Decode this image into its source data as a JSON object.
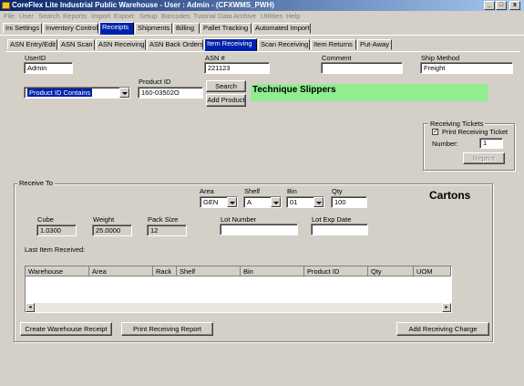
{
  "window": {
    "title": "CoreFlex Lite Industrial Public Warehouse - User : Admin - (CFXWMS_PWH)"
  },
  "menu": [
    "File",
    "User",
    "Search",
    "Reports",
    "Import",
    "Export",
    "Setup",
    "Barcodes",
    "Tutorial Data",
    "Archive",
    "Utilities",
    "Help"
  ],
  "main_tabs": [
    {
      "label": "Ini Settings"
    },
    {
      "label": "Inventory Control"
    },
    {
      "label": "Receipts"
    },
    {
      "label": "Shipments"
    },
    {
      "label": "Billing"
    },
    {
      "label": "Pallet Tracking"
    },
    {
      "label": "Automated Import"
    }
  ],
  "sub_tabs": [
    {
      "label": "ASN Entry/Edit"
    },
    {
      "label": "ASN Scan"
    },
    {
      "label": "ASN Receiving"
    },
    {
      "label": "ASN Back Orders"
    },
    {
      "label": "Item Receiving"
    },
    {
      "label": "Scan Receiving"
    },
    {
      "label": "Item Returns"
    },
    {
      "label": "Put-Away"
    }
  ],
  "form": {
    "userid_label": "UserID",
    "userid_value": "Admin",
    "asn_label": "ASN #",
    "asn_value": "221123",
    "comment_label": "Comment",
    "comment_value": "",
    "shipmethod_label": "Ship Method",
    "shipmethod_value": "Freight",
    "search_mode": "Product ID Contains",
    "productid_label": "Product ID",
    "productid_value": "160-03502O",
    "search_button": "Search",
    "add_product_button": "Add Product",
    "product_description": "Technique Slippers"
  },
  "receiving_tickets": {
    "title": "Receiving Tickets",
    "print_label": "Print Receiving Ticket",
    "print_checked": true,
    "number_label": "Number:",
    "number_value": "1",
    "reprint_button": "Reprint"
  },
  "receive_to": {
    "title": "Receive To",
    "area_label": "Area",
    "area_value": "GEN",
    "shelf_label": "Shelf",
    "shelf_value": "A",
    "bin_label": "Bin",
    "bin_value": "01",
    "qty_label": "Qty",
    "qty_value": "100",
    "unit": "Cartons",
    "cube_label": "Cube",
    "cube_value": "1.0300",
    "weight_label": "Weight",
    "weight_value": "25.0000",
    "packsize_label": "Pack Size",
    "packsize_value": "12",
    "lot_label": "Lot Number",
    "lot_value": "",
    "lotexp_label": "Lot Exp Date",
    "lotexp_value": "",
    "last_item_label": "Last Item Received:",
    "columns": [
      "Warehouse",
      "Area",
      "Rack",
      "Shelf",
      "Bin",
      "Product ID",
      "Qty",
      "UOM"
    ],
    "create_receipt_button": "Create Warehouse Receipt",
    "print_report_button": "Print Receiving Report",
    "add_charge_button": "Add Receiving Charge"
  }
}
